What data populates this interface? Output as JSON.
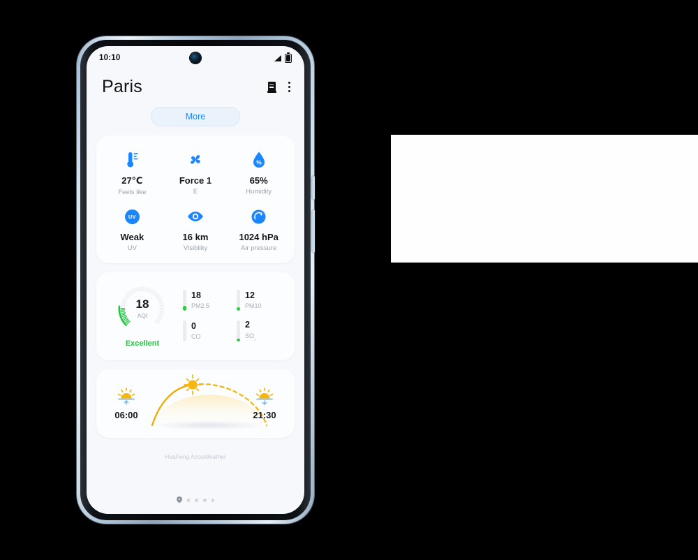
{
  "theme": {
    "accent_blue": "#1a86ff",
    "good_green": "#23c642",
    "sun_yellow": "#f5b60d",
    "screen_bg": "#f6f8fb",
    "card_bg": "#fcfdfe"
  },
  "status_bar": {
    "time": "10:10",
    "signal_icon": "signal-icon",
    "battery_icon": "battery-icon",
    "camera_icon": "front-camera-punch-hole"
  },
  "header": {
    "city": "Paris",
    "city_list_icon": "city-list-icon",
    "overflow_icon": "more-options-icon"
  },
  "more_button": {
    "label": "More"
  },
  "details": {
    "items": [
      {
        "icon": "thermometer-icon",
        "value": "27℃",
        "label": "Feels like"
      },
      {
        "icon": "wind-fan-icon",
        "value": "Force 1",
        "label": "E"
      },
      {
        "icon": "humidity-drop-icon",
        "value": "65%",
        "label": "Humidity"
      },
      {
        "icon": "uv-index-icon",
        "value": "Weak",
        "label": "UV"
      },
      {
        "icon": "visibility-eye-icon",
        "value": "16 km",
        "label": "Visibility"
      },
      {
        "icon": "air-pressure-icon",
        "value": "1024 hPa",
        "label": "Air pressure"
      }
    ],
    "uv_badge_text": "UV"
  },
  "air_quality": {
    "aqi_value": "18",
    "aqi_label": "AQI",
    "status": "Excellent",
    "gauge_fill_percent": 18,
    "pollutants": [
      {
        "value": "18",
        "label": "PM2.5",
        "bar_percent": 22
      },
      {
        "value": "12",
        "label": "PM10",
        "bar_percent": 18
      },
      {
        "value": "0",
        "label": "CO",
        "bar_percent": 0
      },
      {
        "value": "2",
        "label": "SO",
        "sub": "₂",
        "bar_percent": 14
      }
    ]
  },
  "sun": {
    "sunrise_time": "06:00",
    "sunset_time": "21:30",
    "sunrise_icon": "sunrise-icon",
    "sunset_icon": "sunset-icon",
    "sun_marker_icon": "sun-icon"
  },
  "footer": {
    "attribution": "HuaFeng AccuWeather",
    "pager_location_icon": "location-pin-icon",
    "pager_dots": 4
  }
}
